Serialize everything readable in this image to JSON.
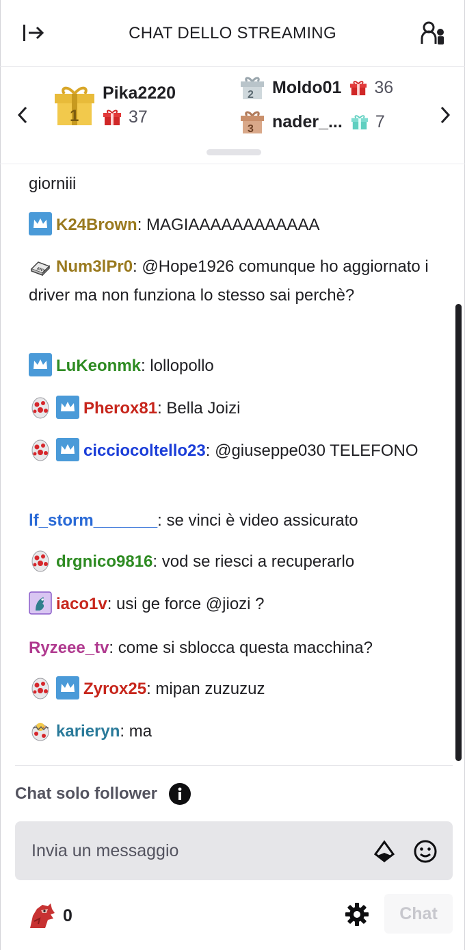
{
  "header": {
    "title": "CHAT DELLO STREAMING",
    "collapse_icon": "collapse-right-icon",
    "users_icon": "community-icon"
  },
  "leaderboard": {
    "first": {
      "name": "Pika2220",
      "amount": "37"
    },
    "second": {
      "name": "Moldo01",
      "amount": "36"
    },
    "third": {
      "name": "nader_...",
      "amount": "7"
    }
  },
  "messages": [
    {
      "user": "",
      "text": "giorniii",
      "color": "#1f1f23"
    },
    {
      "user": "K24Brown",
      "text": ": MAGIAAAAAAAAAAAA",
      "color": "#9a7a1f"
    },
    {
      "user": "Num3lPr0",
      "text": ": @Hope1926 comunque ho aggiornato i driver ma non funziona lo stesso sai perchè?",
      "color": "#9a7a1f"
    },
    {
      "user": "LuKeonmk",
      "text": ": lollopollo",
      "color": "#2e8b22"
    },
    {
      "user": "Pherox81",
      "text": ": Bella Joizi",
      "color": "#c7261c"
    },
    {
      "user": "cicciocoltello23",
      "text": ": @giuseppe030 TELEFONO",
      "color": "#1a3dd8"
    },
    {
      "user": "lf_storm_______",
      "text": ": se vinci è video assicurato",
      "color": "#2a6ad6"
    },
    {
      "user": "drgnico9816",
      "text": ": vod se riesci a recuperarlo",
      "color": "#2e8b22"
    },
    {
      "user": "iaco1v",
      "text": ": usi ge force @jiozi ?",
      "color": "#c7261c"
    },
    {
      "user": "Ryzeee_tv",
      "text": ": come si sblocca questa macchina?",
      "color": "#b03a8f"
    },
    {
      "user": "Zyrox25",
      "text": ": mipan zuzuzuz",
      "color": "#c7261c"
    },
    {
      "user": "karieryn",
      "text": ": ma",
      "color": "#2a7a9a"
    }
  ],
  "follower_mode": {
    "label": "Chat solo follower"
  },
  "input": {
    "placeholder": "Invia un messaggio"
  },
  "footer": {
    "points": "0",
    "chat_button": "Chat"
  },
  "colors": {
    "accent": "#9147ff",
    "sub_badge": "#4a9ad8",
    "scrollbar": "#1f1f23"
  }
}
